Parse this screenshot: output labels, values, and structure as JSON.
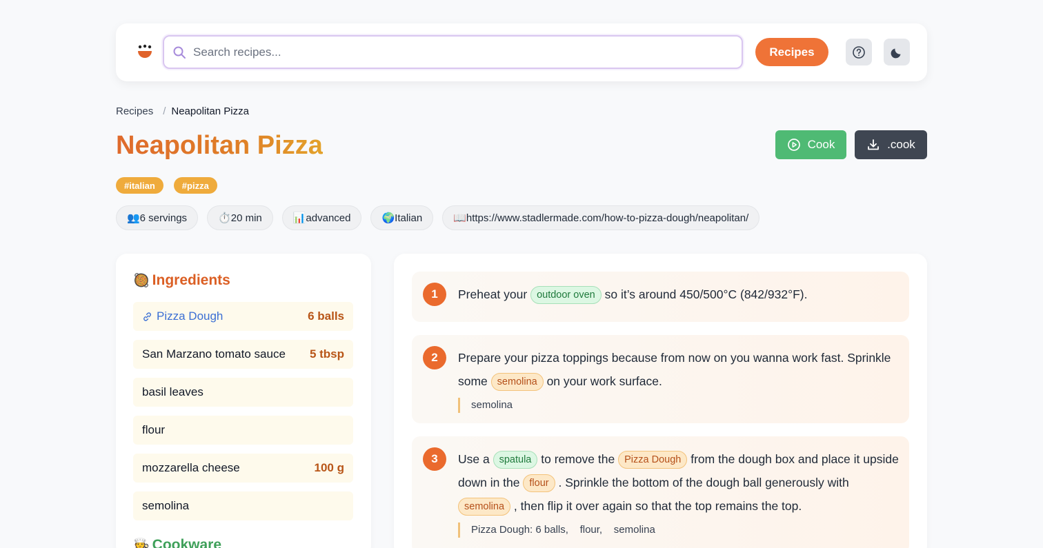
{
  "header": {
    "search_placeholder": "Search recipes...",
    "recipes_button": "Recipes",
    "help_icon": "help-circle-icon",
    "theme_icon": "moon-icon"
  },
  "breadcrumb": {
    "root": "Recipes",
    "separator": "/",
    "current": "Neapolitan Pizza"
  },
  "recipe": {
    "title": "Neapolitan Pizza",
    "cook_label": "Cook",
    "download_label": ".cook",
    "tags": [
      "#italian",
      "#pizza"
    ],
    "meta": {
      "servings": "👥6 servings",
      "time": "⏱️20 min",
      "difficulty": "📊advanced",
      "cuisine": "🌍Italian",
      "source": "📖https://www.stadlermade.com/how-to-pizza-dough/neapolitan/"
    }
  },
  "ingredients": {
    "title": "Ingredients",
    "emoji": "🥘",
    "items": [
      {
        "name": "Pizza Dough",
        "qty": "6 balls",
        "linked": true
      },
      {
        "name": "San Marzano tomato sauce",
        "qty": "5 tbsp"
      },
      {
        "name": "basil leaves",
        "qty": ""
      },
      {
        "name": "flour",
        "qty": ""
      },
      {
        "name": "mozzarella cheese",
        "qty": "100 g"
      },
      {
        "name": "semolina",
        "qty": ""
      }
    ]
  },
  "cookware": {
    "title": "Cookware",
    "emoji": "🧑‍🍳"
  },
  "steps": [
    {
      "number": "1",
      "parts": {
        "t1": "Preheat your",
        "c1": "outdoor oven",
        "t2": "so it’s around 450/500°C (842/932°F)."
      }
    },
    {
      "number": "2",
      "parts": {
        "t1": "Prepare your pizza toppings because from now on you wanna work fast. Sprinkle some",
        "i1": "semolina",
        "t2": "on your work surface."
      },
      "ingredients_line": "semolina"
    },
    {
      "number": "3",
      "parts": {
        "t1": "Use a",
        "c1": "spatula",
        "t2": "to remove the",
        "i1": "Pizza Dough",
        "t3": "from the dough box and place it upside down in the",
        "i2": "flour",
        "t4": ". Sprinkle the bottom of the dough ball generously with",
        "i3": "semolina",
        "t5": ", then flip it over again so that the top remains the top."
      },
      "ingredients_line": "Pizza Dough: 6 balls,    flour,    semolina"
    }
  ],
  "colors": {
    "accent": "#ef7337",
    "cook_green": "#4fba74",
    "download_dark": "#3f4652",
    "tag": "#efab3c",
    "quantity": "#b85517",
    "link": "#3b6fd4"
  }
}
